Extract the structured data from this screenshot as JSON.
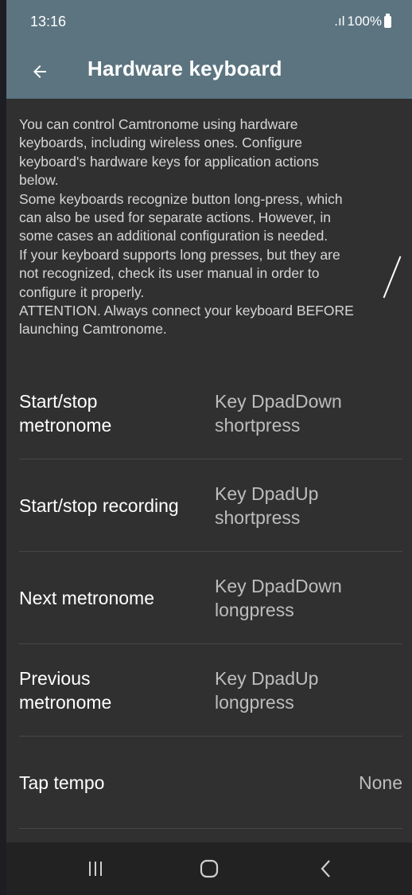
{
  "status_bar": {
    "time": "13:16",
    "signal": ".ıl",
    "battery": "100%"
  },
  "app_bar": {
    "title": "Hardware keyboard",
    "back_icon": "arrow-back-icon"
  },
  "description": "You can control Camtronome using hardware\nkeyboards, including wireless ones. Configure\nkeyboard's hardware keys for application actions\nbelow.\nSome keyboards recognize button long-press, which\ncan also be used for separate actions. However, in\nsome cases an additional configuration is needed.\nIf your keyboard supports long presses, but they are\nnot recognized, check its user manual in order to\nconfigure it properly.\nATTENTION. Always connect your keyboard BEFORE\nlaunching Camtronome.",
  "settings": [
    {
      "label": "Start/stop\nmetronome",
      "value": "Key DpadDown\nshortpress"
    },
    {
      "label": "Start/stop recording",
      "value": "Key DpadUp\nshortpress"
    },
    {
      "label": "Next metronome",
      "value": "Key DpadDown\nlongpress"
    },
    {
      "label": "Previous\nmetronome",
      "value": "Key DpadUp\nlongpress"
    },
    {
      "label": "Tap tempo",
      "value": "None"
    }
  ],
  "nav_bar": {
    "recents_icon": "recents-icon",
    "home_icon": "home-icon",
    "back_icon": "nav-back-icon"
  },
  "colors": {
    "app_bar": "#5b7480",
    "background": "#303030",
    "nav_bar": "#222222"
  }
}
